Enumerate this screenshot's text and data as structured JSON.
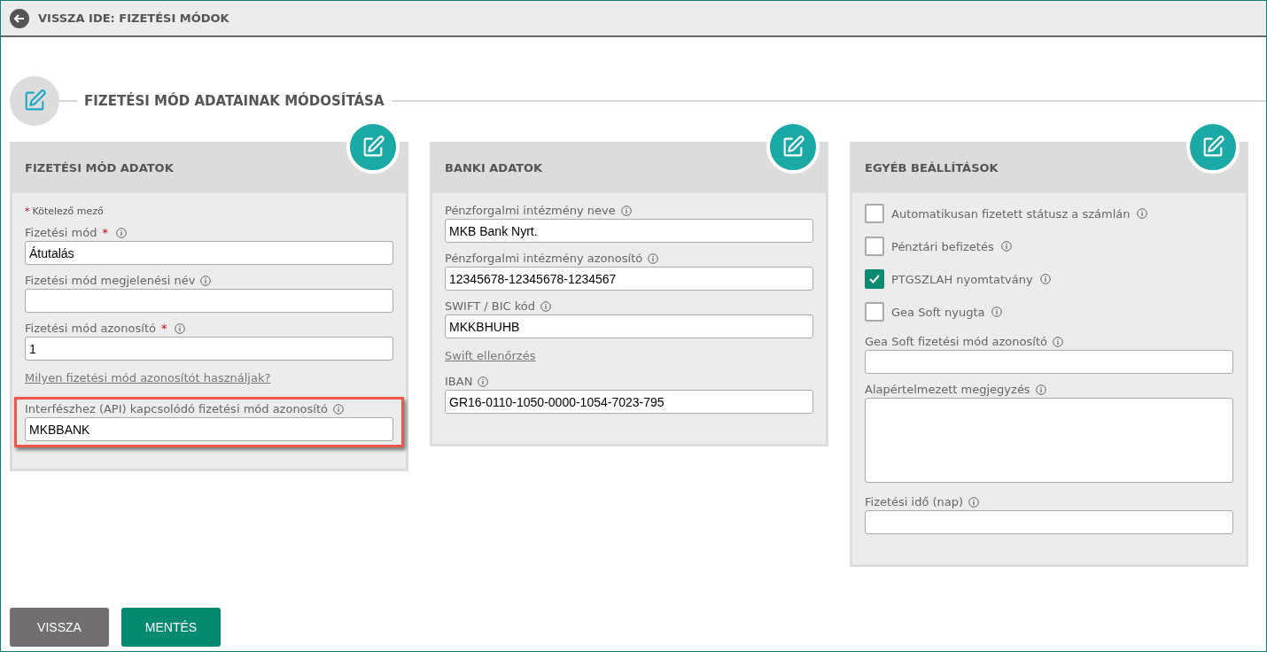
{
  "back_bar": {
    "label": "VISSZA IDE: FIZETÉSI MÓDOK"
  },
  "section_title": "FIZETÉSI MÓD ADATAINAK MÓDOSÍTÁSA",
  "cards": [
    {
      "title": "FIZETÉSI MÓD ADATOK",
      "items": [
        {
          "kind": "note",
          "mark": "*",
          "text": "Kötelező mező"
        },
        {
          "kind": "input",
          "label": "Fizetési mód",
          "required_mark": "*",
          "value": "Átutalás",
          "highlighted": false
        },
        {
          "kind": "input",
          "label": "Fizetési mód megjelenési név",
          "highlighted": false
        },
        {
          "kind": "input",
          "label": "Fizetési mód azonosító",
          "required_mark": "*",
          "value": "1",
          "highlighted": false
        },
        {
          "kind": "link",
          "text": "Milyen fizetési mód azonosítót használjak?"
        },
        {
          "kind": "input",
          "label": "Interfészhez (API) kapcsolódó fizetési mód azonosító",
          "value": "MKBBANK",
          "highlighted": true
        }
      ]
    },
    {
      "title": "BANKI ADATOK",
      "items": [
        {
          "kind": "input",
          "label": "Pénzforgalmi intézmény neve",
          "value": "MKB Bank Nyrt.",
          "highlighted": false
        },
        {
          "kind": "input",
          "label": "Pénzforgalmi intézmény azonosító",
          "value": "12345678-12345678-1234567",
          "highlighted": false
        },
        {
          "kind": "input",
          "label": "SWIFT / BIC kód",
          "value": "MKKBHUHB",
          "highlighted": false
        },
        {
          "kind": "link",
          "text": "Swift ellenőrzés"
        },
        {
          "kind": "input",
          "label": "IBAN",
          "value": "GR16-0110-1050-0000-1054-7023-795",
          "highlighted": false
        }
      ]
    },
    {
      "title": "EGYÉB BEÁLLÍTÁSOK",
      "items": [
        {
          "kind": "checkbox",
          "label": "Automatikusan fizetett státusz a számlán",
          "checked": false
        },
        {
          "kind": "checkbox",
          "label": "Pénztári befizetés",
          "checked": false
        },
        {
          "kind": "checkbox",
          "label": "PTGSZLAH nyomtatvány",
          "checked": true
        },
        {
          "kind": "checkbox",
          "label": "Gea Soft nyugta",
          "checked": false
        },
        {
          "kind": "input",
          "label": "Gea Soft fizetési mód azonosító",
          "highlighted": false
        },
        {
          "kind": "textarea",
          "label": "Alapértelmezett megjegyzés",
          "highlighted": false
        },
        {
          "kind": "input",
          "label": "Fizetési idő (nap)",
          "highlighted": false
        }
      ]
    }
  ],
  "buttons": [
    {
      "label": "VISSZA",
      "kind": "secondary"
    },
    {
      "label": "MENTÉS",
      "kind": "primary"
    }
  ]
}
